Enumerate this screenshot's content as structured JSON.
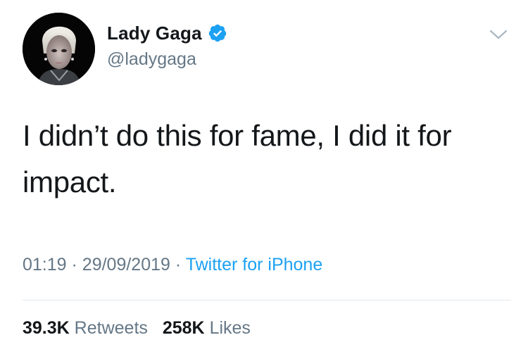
{
  "tweet": {
    "author": {
      "display_name": "Lady Gaga",
      "handle": "@ladygaga",
      "verified": true
    },
    "text": "I didn’t do this for fame, I did it for impact.",
    "time": "01:19",
    "date": "29/09/2019",
    "separator": "·",
    "source": "Twitter for iPhone",
    "stats": {
      "retweets_count": "39.3K",
      "retweets_label": "Retweets",
      "likes_count": "258K",
      "likes_label": "Likes"
    }
  },
  "icons": {
    "verified": "verified-badge-icon",
    "menu": "chevron-down-icon"
  },
  "colors": {
    "text": "#14171a",
    "secondary": "#657786",
    "accent": "#1da1f2",
    "divider": "#e1e8ed"
  }
}
